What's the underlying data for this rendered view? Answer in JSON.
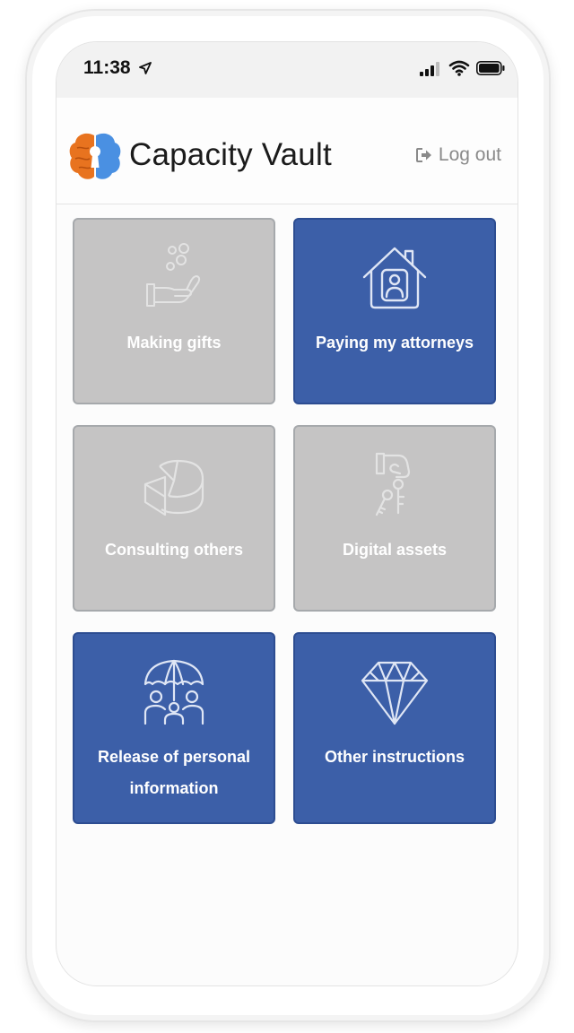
{
  "status_bar": {
    "time": "11:38",
    "icons": [
      "location-arrow-icon",
      "cellular-signal-icon",
      "wifi-icon",
      "battery-icon"
    ]
  },
  "header": {
    "app_title": "Capacity Vault",
    "logout_label": "Log out",
    "logo_colors": {
      "left": "#e8731f",
      "right": "#4a90e2"
    }
  },
  "tiles": [
    {
      "label": "Making gifts",
      "icon": "hand-gift-icon",
      "state": "disabled",
      "color": "#c5c4c4"
    },
    {
      "label": "Paying my attorneys",
      "icon": "house-person-icon",
      "state": "active",
      "color": "#3c5fa8"
    },
    {
      "label": "Consulting others",
      "icon": "pie-chart-icon",
      "state": "disabled",
      "color": "#c5c4c4"
    },
    {
      "label": "Digital assets",
      "icon": "hand-keys-icon",
      "state": "disabled",
      "color": "#c5c4c4"
    },
    {
      "label": "Release of personal information",
      "icon": "umbrella-family-icon",
      "state": "active",
      "color": "#3c5fa8"
    },
    {
      "label": "Other instructions",
      "icon": "diamond-icon",
      "state": "active",
      "color": "#3c5fa8"
    }
  ]
}
